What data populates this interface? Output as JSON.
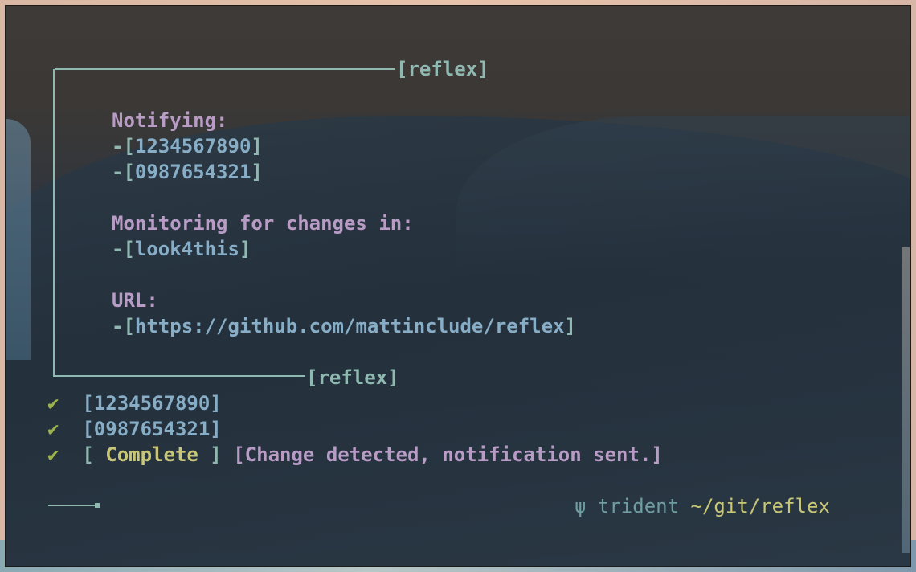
{
  "header_tag": "[reflex]",
  "footer_tag": "[reflex]",
  "notifying_label": "Notifying:",
  "numbers": [
    "1234567890",
    "0987654321"
  ],
  "monitoring_label": "Monitoring for changes in:",
  "monitor_target": "look4this",
  "url_label": "URL:",
  "url": "https://github.com/mattinclude/reflex",
  "check_mark": "✔",
  "status_lines": [
    {
      "text": "[1234567890]"
    },
    {
      "text": "[0987654321]"
    }
  ],
  "complete": {
    "open": "[ ",
    "label": "Complete",
    "close": " ]",
    "message": "[Change detected, notification sent.]"
  },
  "prompt": {
    "symbol": "ψ",
    "host": "trident",
    "path": "~/git/reflex"
  },
  "colors": {
    "frame": "#8fb9b0",
    "value": "#87aec6",
    "label": "#b89cc6",
    "complete": "#c9c777",
    "check": "#9cb34a"
  }
}
